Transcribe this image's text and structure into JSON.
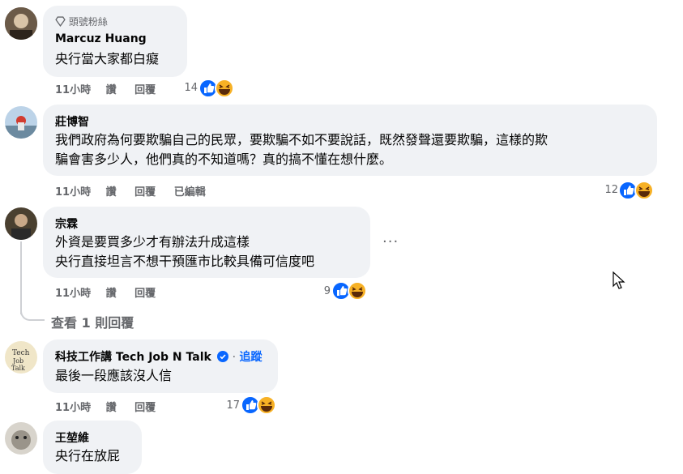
{
  "comments": [
    {
      "badge": "頭號粉絲",
      "name": "Marcuz Huang",
      "text_lines": [
        "央行當大家都白癡"
      ],
      "time": "11小時",
      "like": "讚",
      "reply": "回覆",
      "reactions": "14"
    },
    {
      "name": "莊博智",
      "text_lines": [
        "我們政府為何要欺騙自己的民眾，要欺騙不如不要說話，既然發聲還要欺騙，這樣的欺",
        "騙會害多少人，他們真的不知道嗎？真的搞不懂在想什麼。"
      ],
      "time": "11小時",
      "like": "讚",
      "reply": "回覆",
      "edited": "已編輯",
      "reactions": "12"
    },
    {
      "name": "宗霖",
      "text_lines": [
        "外資是要買多少才有辦法升成這樣",
        "央行直接坦言不想干預匯市比較具備可信度吧"
      ],
      "time": "11小時",
      "like": "讚",
      "reply": "回覆",
      "reactions": "9",
      "view_replies": "查看 1 則回覆"
    },
    {
      "name": "科技工作講 Tech Job N Talk",
      "follow": "追蹤",
      "text_lines": [
        "最後一段應該沒人信"
      ],
      "time": "11小時",
      "like": "讚",
      "reply": "回覆",
      "reactions": "17"
    },
    {
      "name": "王堃維",
      "text_lines": [
        "央行在放屁"
      ]
    }
  ],
  "more_menu": "···",
  "colors": {
    "bubble": "#f0f2f5",
    "meta": "#65676b",
    "like_blue": "#0866ff",
    "haha_yellow": "#f7b125"
  },
  "icons": [
    "diamond-icon",
    "verified-badge-icon",
    "like-reaction-icon",
    "haha-reaction-icon",
    "more-options-icon",
    "mouse-cursor-icon"
  ]
}
